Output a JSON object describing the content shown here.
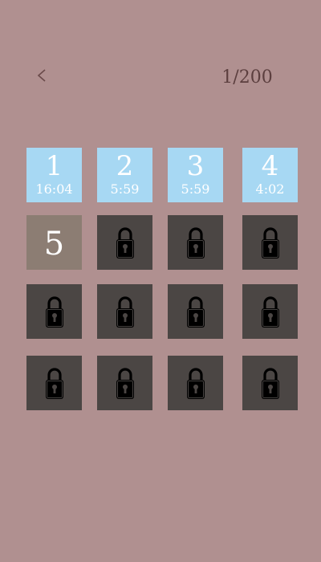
{
  "header": {
    "back_icon": "chevron-left-icon",
    "progress": "1/200"
  },
  "levels": [
    {
      "number": "1",
      "time": "16:04",
      "state": "completed"
    },
    {
      "number": "2",
      "time": "5:59",
      "state": "completed"
    },
    {
      "number": "3",
      "time": "5:59",
      "state": "completed"
    },
    {
      "number": "4",
      "time": "4:02",
      "state": "completed"
    },
    {
      "number": "5",
      "state": "current"
    },
    {
      "state": "locked"
    },
    {
      "state": "locked"
    },
    {
      "state": "locked"
    },
    {
      "state": "locked"
    },
    {
      "state": "locked"
    },
    {
      "state": "locked"
    },
    {
      "state": "locked"
    },
    {
      "state": "locked"
    },
    {
      "state": "locked"
    },
    {
      "state": "locked"
    },
    {
      "state": "locked"
    }
  ],
  "colors": {
    "background": "#b09090",
    "completed_tile": "#a7d8f3",
    "current_tile": "#8c7d73",
    "locked_tile": "#4b4644",
    "progress_text": "#5c3f3f"
  },
  "icons": {
    "locked": "lock-icon"
  }
}
